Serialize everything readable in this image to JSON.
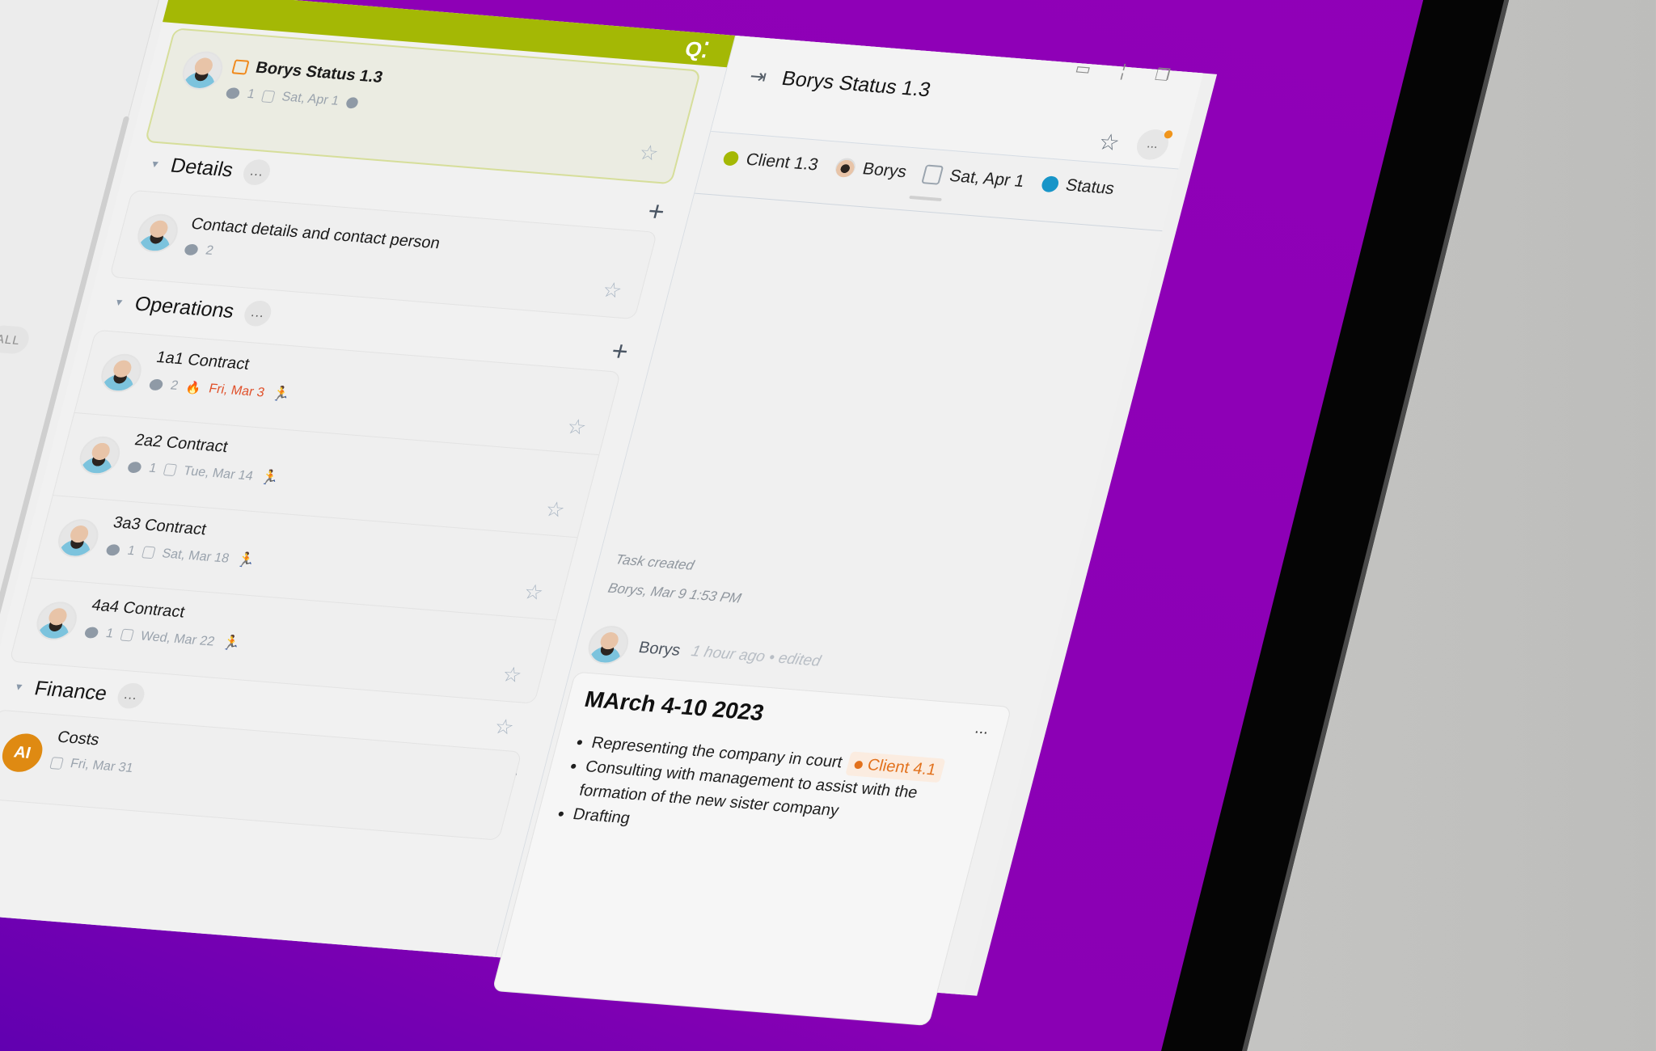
{
  "colors": {
    "brand": "#a4b805",
    "overdue": "#e0502a",
    "tag": "#e2711c",
    "status": "#1895c8",
    "desktop": "#8a00b4"
  },
  "sidebar": {
    "filter_label": "ALL"
  },
  "list": {
    "logo": "Q⁚",
    "active_task": {
      "title": "Borys Status 1.3",
      "comments": "1",
      "due": "Sat, Apr 1"
    },
    "sections": [
      {
        "title": "Details",
        "more": "...",
        "items": [
          {
            "title": "Contact details and contact person",
            "comments": "2"
          }
        ]
      },
      {
        "title": "Operations",
        "more": "...",
        "items": [
          {
            "title": "1a1 Contract",
            "comments": "2",
            "due": "Fri, Mar 3",
            "overdue": true
          },
          {
            "title": "2a2 Contract",
            "comments": "1",
            "due": "Tue, Mar 14"
          },
          {
            "title": "3a3 Contract",
            "comments": "1",
            "due": "Sat, Mar 18"
          },
          {
            "title": "4a4 Contract",
            "comments": "1",
            "due": "Wed, Mar 22"
          }
        ]
      },
      {
        "title": "Finance",
        "more": "...",
        "items": [
          {
            "title": "Costs",
            "avatar_initials": "AI",
            "due": "Fri, Mar 31"
          }
        ]
      }
    ]
  },
  "detail": {
    "title": "Borys Status 1.3",
    "props": {
      "client": "Client 1.3",
      "assignee": "Borys",
      "due": "Sat, Apr 1",
      "status": "Status"
    },
    "more": "...",
    "activity": {
      "event": "Task created",
      "meta": "Borys, Mar 9 1:53 PM"
    },
    "comment": {
      "author": "Borys",
      "time": "1 hour ago • edited",
      "title": "MArch 4-10 2023",
      "more": "...",
      "bullets": [
        "Representing the company in court",
        "Consulting with management to assist with the formation of the new sister company",
        "Drafting"
      ],
      "tag": "Client 4.1"
    }
  }
}
